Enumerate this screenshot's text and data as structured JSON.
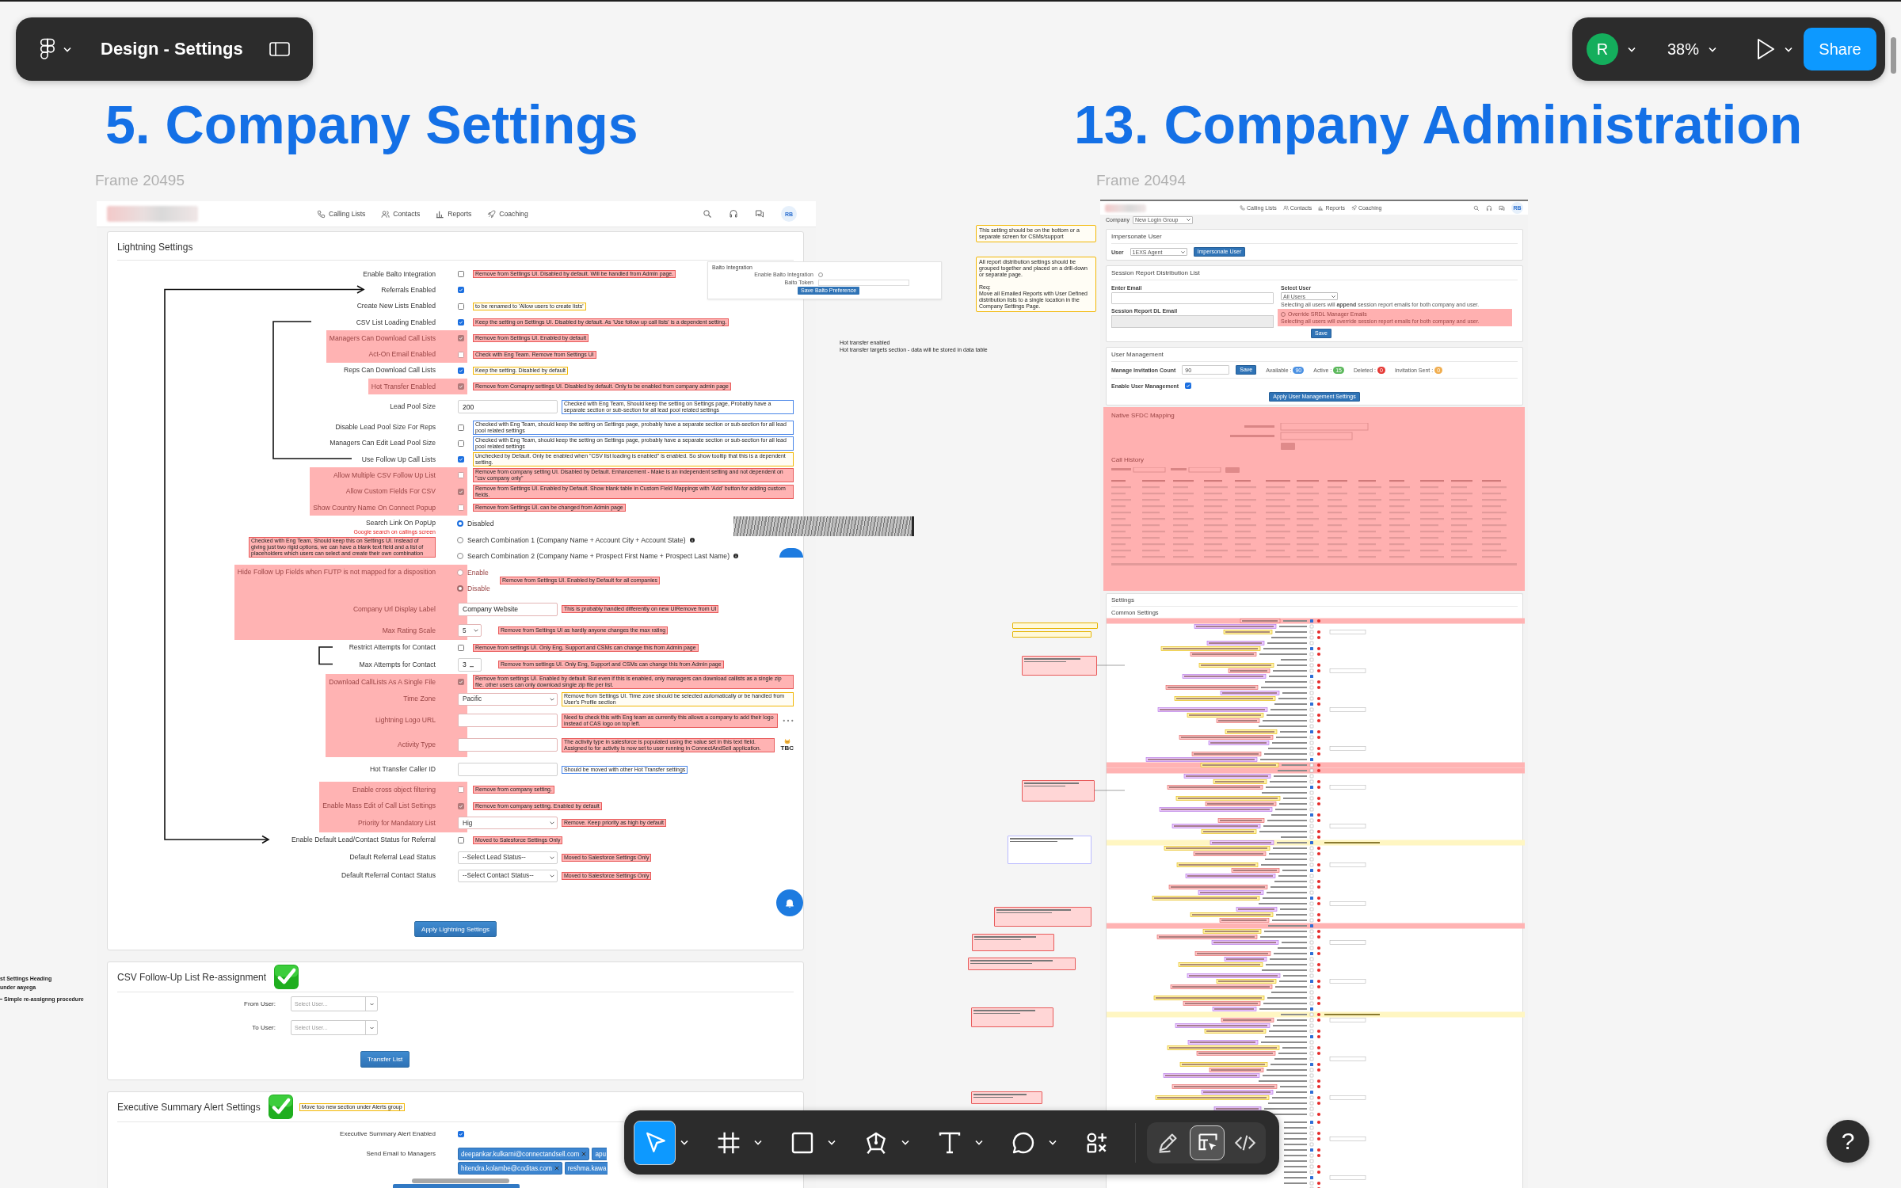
{
  "file_toolbar": {
    "file_name": "Design - Settings"
  },
  "view_toolbar": {
    "avatar": "R",
    "zoom": "38%",
    "share": "Share"
  },
  "left_section": {
    "heading": "5. Company Settings",
    "frame_label": "Frame 20495",
    "app_nav": {
      "items": [
        "Calling Lists",
        "Contacts",
        "Reports",
        "Coaching"
      ],
      "avatar": "RB"
    },
    "lightning_settings": {
      "title": "Lightning Settings",
      "apply_button": "Apply Lightning Settings",
      "rows": [
        {
          "kind": "checkbox",
          "label": "Enable Balto Integration",
          "checked": false,
          "removed": false,
          "note": {
            "kind": "remove",
            "text": "Remove from Settings UI. Disabled by default. Will be handled from Admin page."
          }
        },
        {
          "kind": "checkbox",
          "label": "Referrals Enabled",
          "checked": true,
          "removed": false
        },
        {
          "kind": "checkbox",
          "label": "Create New Lists Enabled",
          "checked": false,
          "removed": false,
          "note": {
            "kind": "caution",
            "text": "to be renamed to 'Allow users to create lists'"
          }
        },
        {
          "kind": "checkbox",
          "label": "CSV List Loading Enabled",
          "checked": true,
          "removed": false,
          "note": {
            "kind": "remove",
            "text": "Keep the setting on Settings UI. Disabled by default. As 'Use follow up call lists' is a dependent setting."
          }
        },
        {
          "kind": "checkbox",
          "label": "Managers Can Download Call Lists",
          "checked": true,
          "removed": true,
          "note": {
            "kind": "remove",
            "text": "Remove from Settings UI. Enabled by default"
          }
        },
        {
          "kind": "checkbox",
          "label": "Act-On Email Enabled",
          "checked": false,
          "removed": true,
          "note": {
            "kind": "remove",
            "text": "Check with Eng Team. Remove from Settings UI"
          }
        },
        {
          "kind": "checkbox",
          "label": "Reps Can Download Call Lists",
          "checked": true,
          "removed": false,
          "note": {
            "kind": "caution",
            "text": "Keep the setting. Disabled by default"
          }
        },
        {
          "kind": "checkbox",
          "label": "Hot Transfer Enabled",
          "checked": true,
          "removed": true,
          "note": {
            "kind": "remove",
            "text": "Remove from Comapny settings UI. Disabled by default. Only to be enabled from company admin page"
          }
        },
        {
          "kind": "input",
          "label": "Lead Pool Size",
          "value": "200",
          "removed": false,
          "note": {
            "kind": "info",
            "text": "Checked with Eng Team, Should keep the setting on Settings page, Probably have a separate section or sub-section for all lead pool related settings"
          }
        },
        {
          "kind": "checkbox",
          "label": "Disable Lead Pool Size For Reps",
          "checked": false,
          "removed": false,
          "note": {
            "kind": "info",
            "text": "Checked with Eng Team, should keep the setting on Settings page, probably have a separate section or sub-section for all lead pool related settings"
          }
        },
        {
          "kind": "checkbox",
          "label": "Managers Can Edit Lead Pool Size",
          "checked": false,
          "removed": false,
          "note": {
            "kind": "info",
            "text": "Checked with Eng Team, should keep the setting on Settings page, probably have a separate section or sub-section for all lead pool related settings"
          }
        },
        {
          "kind": "checkbox",
          "label": "Use Follow Up Call Lists",
          "checked": true,
          "removed": false,
          "note": {
            "kind": "caution",
            "text": "Unchecked by Default. Only be enabled when \"CSV list loading is enabled\" is enabled. So show tooltip that this is a dependent setting."
          }
        },
        {
          "kind": "checkbox",
          "label": "Allow Multiple CSV Follow Up List",
          "checked": false,
          "removed": true,
          "note": {
            "kind": "remove",
            "text": "Remove from company setting UI. Disabled by Default. Enhancement - Make is an independent setting and not dependent on \"csv company only\""
          }
        },
        {
          "kind": "checkbox",
          "label": "Allow Custom Fields For CSV",
          "checked": true,
          "removed": true,
          "note": {
            "kind": "remove",
            "text": "Remove from Settings UI. Enabled by Default. Show blank table in Custom Field Mappings with 'Add' button for adding custom fields."
          }
        },
        {
          "kind": "checkbox",
          "label": "Show Country Name On Connect Popup",
          "checked": false,
          "removed": true,
          "note": {
            "kind": "remove",
            "text": "Remove from Settings UI. can be changed from Admin page"
          }
        },
        {
          "kind": "radio",
          "label": "Search Link On PopUp",
          "removed": false,
          "caption": "Google search on callings screen",
          "side_note": {
            "kind": "remove",
            "text": "Checked with Eng Team, Should keep this on Settings UI. Instead of giving just two rigid options, we can have a blank text field and a list of placeholders which users can select and create their own combination"
          },
          "options": [
            {
              "label": "Disabled",
              "selected": true,
              "info": false
            },
            {
              "label": "Search Combination 1 (Company Name + Account City + Account State)",
              "selected": false,
              "info": true
            },
            {
              "label": "Search Combination 2 (Company Name + Prospect First Name + Prospect Last Name)",
              "selected": false,
              "info": true
            }
          ]
        },
        {
          "kind": "radio",
          "label": "Hide Follow Up Fields when FUTP is not mapped for a disposition",
          "removed": true,
          "options": [
            {
              "label": "Enable",
              "selected": false,
              "info": false
            },
            {
              "label": "Disable",
              "selected": true,
              "info": false
            }
          ],
          "note": {
            "kind": "remove",
            "text": "Remove from Settings UI. Enabled by Default for all companies"
          }
        },
        {
          "kind": "input",
          "label": "Company Url Display Label",
          "value": "Company Website",
          "removed": true,
          "note": {
            "kind": "remove",
            "text": "This is probably handled differently on new UIRemove from UI"
          }
        },
        {
          "kind": "scale",
          "label": "Max Rating Scale",
          "value": "5",
          "removed": true,
          "note": {
            "kind": "remove",
            "text": "Remove from Settings UI as hardly anyone changes the max rating"
          }
        },
        {
          "kind": "checkbox",
          "label": "Restrict Attempts for Contact",
          "checked": false,
          "removed": false,
          "note": {
            "kind": "remove",
            "text": "Remove from settings UI. Only Eng, Support and CSMs can change this from Admin page"
          }
        },
        {
          "kind": "number",
          "label": "Max Attempts for Contact",
          "value": "3",
          "removed": false,
          "note": {
            "kind": "remove",
            "text": "Remove from settings UI. Only Eng, Support and CSMs can change this from Admin page"
          }
        },
        {
          "kind": "checkbox",
          "label": "Download CallLists As A Single File",
          "checked": true,
          "removed": true,
          "note": {
            "kind": "remove",
            "text": "Remove from settings UI. Enabled by default. But even if this is enabled, only managers can download callists as a single zip file. other users can only download single zip file per list."
          }
        },
        {
          "kind": "select",
          "label": "Time Zone",
          "value": "Pacific",
          "removed": true,
          "note": {
            "kind": "caution",
            "text": "Remove from Settings UI. Time zone should be selected automatically or be handled from User's Profile section"
          }
        },
        {
          "kind": "input",
          "label": "Lightning Logo URL",
          "removed": true,
          "ellipsis": true,
          "note": {
            "kind": "remove",
            "text": "Need to check this with Eng team as currently this allows a company to add their logo instead of CAS logo on top left."
          }
        },
        {
          "kind": "input",
          "label": "Activity Type",
          "removed": true,
          "flag": "TBC",
          "note": {
            "kind": "remove",
            "text": "The activity type in salesforce is populated using the value set in this text field. Assigned to for activity is now set to user running in ConnectAndSell application."
          }
        },
        {
          "kind": "input",
          "label": "Hot Transfer Caller ID",
          "removed": false,
          "note": {
            "kind": "info",
            "text": "Should be moved with other Hot Transfer settings"
          }
        },
        {
          "kind": "checkbox",
          "label": "Enable cross object filtering",
          "checked": false,
          "removed": true,
          "note": {
            "kind": "remove",
            "text": "Remove from company setting."
          }
        },
        {
          "kind": "checkbox",
          "label": "Enable Mass Edit of Call List Settings",
          "checked": true,
          "removed": true,
          "note": {
            "kind": "remove",
            "text": "Remove from company setting. Enabled by default"
          }
        },
        {
          "kind": "select",
          "label": "Priority for Mandatory List",
          "value": "Hig",
          "removed": true,
          "note": {
            "kind": "remove",
            "text": "Remove. Keep priority as high by default"
          }
        },
        {
          "kind": "checkbox",
          "label": "Enable Default Lead/Contact Status for Referral",
          "checked": false,
          "removed": false,
          "note": {
            "kind": "remove",
            "text": "Moved to Salesforce Settings Only"
          }
        },
        {
          "kind": "select",
          "label": "Default Referral Lead Status",
          "value": "--Select Lead Status--",
          "removed": false,
          "note": {
            "kind": "remove",
            "text": "Moved to Salesforce Settings Only"
          }
        },
        {
          "kind": "select",
          "label": "Default Referral Contact Status",
          "value": "--Select Contact Status--",
          "removed": false,
          "note": {
            "kind": "remove",
            "text": "Moved to Salesforce Settings Only"
          }
        }
      ]
    },
    "balto_mockup": {
      "title": "Balto Integration",
      "toggle_label": "Enable Balto Integration",
      "toggle_on": false,
      "token_label": "Balto Token",
      "button": "Save Balto Preference"
    },
    "hot_transfer_note": [
      "Hot transfer enabled",
      "Hot transfer targets section - data will be stored in data table"
    ],
    "side_notes": [
      {
        "text": "st Settings Heading\nunder aayega",
        "leader": false
      },
      {
        "text": "Simple re-assignng procedure",
        "leader": true
      }
    ],
    "csv_reassignment": {
      "title": "CSV Follow-Up List Re-assignment",
      "done": true,
      "fields": [
        {
          "label": "From User:",
          "placeholder": "Select User..."
        },
        {
          "label": "To User:",
          "placeholder": "Select User..."
        }
      ],
      "button": "Transfer List"
    },
    "executive_summary": {
      "title": "Executive Summary Alert Settings",
      "done": true,
      "note": "Move too new section under Alerts group",
      "enabled_label": "Executive Summary Alert Enabled",
      "checked": true,
      "emails_label": "Send Email to Managers",
      "emails": [
        {
          "text": "deepankar.kulkarni@connectandsell.com",
          "cut": false
        },
        {
          "text": "apu",
          "cut": true
        },
        {
          "text": "hitendra.kolambe@coditas.com",
          "cut": false
        },
        {
          "text": "reshma.kawa",
          "cut": true
        }
      ]
    }
  },
  "right_section": {
    "heading": "13. Company Administration",
    "frame_label": "Frame 20494",
    "app_nav": {
      "items": [
        "Calling Lists",
        "Contacts",
        "Reports",
        "Coaching"
      ],
      "avatar": "RB"
    },
    "company": {
      "label": "Company",
      "value": "New Login Group"
    },
    "impersonate": {
      "title": "Impersonate User",
      "label": "User",
      "value": "1EXS Agent",
      "button": "Impersonate User"
    },
    "session_report": {
      "title": "Session Report Distribution List",
      "email_label": "Enter Email",
      "dl_label": "Session Report DL Email",
      "user_label": "Select User",
      "user_value": "All Users",
      "hint": "Selecting all users will **append** session report emails for both company and user.",
      "override_label": "Override SRDL Manager Emails",
      "override_selected": false,
      "override_hint": "Selecting all users will override session report emails for both company and user.",
      "button": "Save"
    },
    "user_management": {
      "title": "User Management",
      "count_label": "Manage Invitation Count",
      "count_value": "90",
      "save": "Save",
      "stats": [
        {
          "label": "Available :",
          "value": "90",
          "color": "#4a90e2"
        },
        {
          "label": "Active :",
          "value": "15",
          "color": "#5cb85c"
        },
        {
          "label": "Deleted :",
          "value": "0",
          "color": "#e53935"
        },
        {
          "label": "Invitation Sent :",
          "value": "0",
          "color": "#f0ad4e"
        }
      ],
      "enable_label": "Enable User Management",
      "enabled": true,
      "button": "Apply User Management Settings"
    },
    "removed_sections": [
      "Native SFDC Mapping",
      "Call History"
    ],
    "settings": {
      "title": "Settings",
      "subtitle": "Common Settings"
    },
    "side_notes": [
      "This setting should be on the bottom or a separate screen for CSMs/support",
      "All report distribution settings should be grouped together and placed on a drill-down or separate page.\n\nReq:\nMove all Emailed Reports with User Defined distribution lists to a single location in the Company Settings Page."
    ]
  },
  "tool_bar": {
    "tools": [
      {
        "kind": "move",
        "selected": true,
        "dropdown": true
      },
      {
        "kind": "frame",
        "selected": false,
        "dropdown": true
      },
      {
        "kind": "shape",
        "selected": false,
        "dropdown": true
      },
      {
        "kind": "pen",
        "selected": false,
        "dropdown": true
      },
      {
        "kind": "text",
        "selected": false,
        "dropdown": true
      },
      {
        "kind": "comment",
        "selected": false,
        "dropdown": true
      },
      {
        "kind": "actions",
        "selected": false,
        "dropdown": false
      }
    ],
    "modes": [
      {
        "kind": "draw",
        "selected": false
      },
      {
        "kind": "design",
        "selected": true
      },
      {
        "kind": "dev",
        "selected": false
      }
    ]
  },
  "help": "?"
}
